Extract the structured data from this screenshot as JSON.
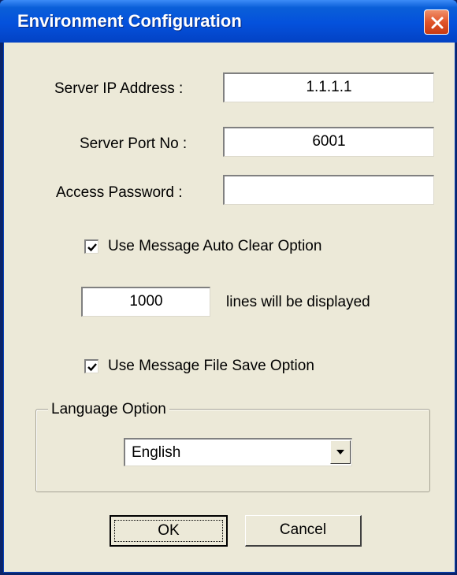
{
  "window": {
    "title": "Environment Configuration"
  },
  "form": {
    "server_ip": {
      "label": "Server IP Address :",
      "value": "1.1.1.1"
    },
    "server_port": {
      "label": "Server Port No :",
      "value": "6001"
    },
    "password": {
      "label": "Access Password :",
      "value": ""
    },
    "auto_clear": {
      "label": "Use Message Auto Clear Option",
      "checked": true
    },
    "lines": {
      "value": "1000",
      "suffix": "lines will be displayed"
    },
    "file_save": {
      "label": "Use Message File Save Option",
      "checked": true
    }
  },
  "language": {
    "group_label": "Language Option",
    "selected": "English"
  },
  "buttons": {
    "ok": "OK",
    "cancel": "Cancel"
  },
  "icons": {
    "close": "close-icon",
    "check": "checkmark-icon",
    "dropdown": "chevron-down-icon"
  },
  "colors": {
    "title_bar": "#0451dc",
    "dialog_bg": "#ece9d8",
    "close_button": "#e0542a"
  }
}
